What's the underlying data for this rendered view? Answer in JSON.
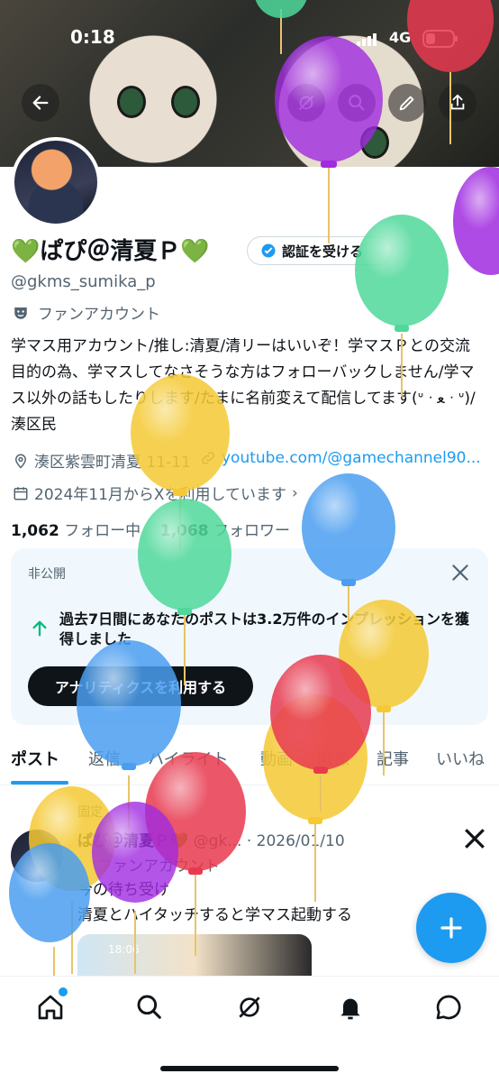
{
  "status_bar": {
    "time": "0:18",
    "network": "4G"
  },
  "profile": {
    "name": "💚ぱぴ＠清夏Ｐ💚",
    "handle": "@gkms_sumika_p",
    "account_type": "ファンアカウント",
    "bio": "学マス用アカウント/推し:清夏/清リーはいいぞ！学マスＰとの交流目的の為、学マスしてなさそうな方はフォローバックしません/学マス以外の話もしたりします/たまに名前変えて配信してます(ᐡ ᐧ ﻌ ᐧ ᐡ)/湊区民",
    "location": "湊区紫雲町清夏 11-11",
    "website": "youtube.com/@gamechannel90...",
    "joined": "2024年11月からXを利用しています",
    "following_count": "1,062",
    "following_label": "フォロー中",
    "followers_count": "1,068",
    "followers_label": "フォロワー"
  },
  "verify_button": "認証を受ける",
  "private_card": {
    "label": "非公開",
    "message": "過去7日間にあなたのポストは3.2万件のインプレッションを獲得しました",
    "button": "アナリティクスを利用する"
  },
  "tabs": [
    "ポスト",
    "返信",
    "ハイライト",
    "動画",
    "画像",
    "記事",
    "いいね"
  ],
  "pinned_post": {
    "pinned_label": "固定",
    "author": "ぱぴ＠清夏Ｐ💚",
    "handle": "@gk...",
    "date": "2026/01/10",
    "account_type": "ファンアカウント",
    "line1": "今の待ち受け",
    "line2": "清夏とハイタッチすると学マス起動する",
    "thumb_time": "18:06"
  },
  "colors": {
    "accent": "#1d9bf0",
    "text": "#0f1419",
    "subtext": "#536471"
  },
  "icons": [
    "back-arrow-icon",
    "grok-icon",
    "search-icon",
    "edit-icon",
    "share-icon",
    "verified-badge-icon",
    "theater-mask-icon",
    "location-icon",
    "link-icon",
    "calendar-icon",
    "close-icon",
    "up-arrow-icon",
    "x-logo-icon",
    "plus-icon",
    "home-icon",
    "explore-icon",
    "grok-nav-icon",
    "bell-icon",
    "messages-icon"
  ]
}
